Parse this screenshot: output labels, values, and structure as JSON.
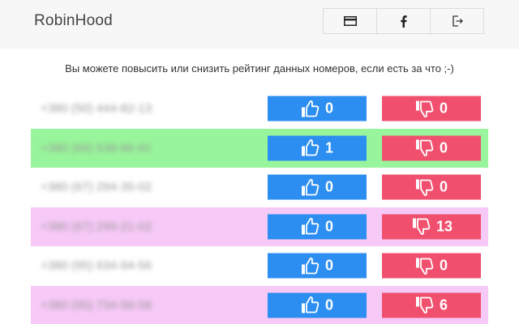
{
  "header": {
    "brand": "RobinHood",
    "buttons": [
      {
        "name": "card-icon"
      },
      {
        "name": "facebook-icon"
      },
      {
        "name": "logout-icon"
      }
    ]
  },
  "intro": "Вы можете повысить или снизить рейтинг данных номеров, если есть за что ;-)",
  "rows": [
    {
      "phone": "+380 (50) 444-82-13",
      "likes": "0",
      "dislikes": "0",
      "highlight": "none"
    },
    {
      "phone": "+380 (66) 538-86-91",
      "likes": "1",
      "dislikes": "0",
      "highlight": "green"
    },
    {
      "phone": "+380 (67) 294-35-02",
      "likes": "0",
      "dislikes": "0",
      "highlight": "none"
    },
    {
      "phone": "+380 (67) 299-21-02",
      "likes": "0",
      "dislikes": "13",
      "highlight": "pink"
    },
    {
      "phone": "+380 (95) 634-94-56",
      "likes": "0",
      "dislikes": "0",
      "highlight": "none"
    },
    {
      "phone": "+380 (95) 734-56-58",
      "likes": "0",
      "dislikes": "6",
      "highlight": "pink"
    }
  ],
  "colors": {
    "like": "#2b8ef0",
    "dislike": "#f0506e",
    "green": "#99f59b",
    "pink": "#f7c9f7"
  },
  "icons": {
    "like": "thumbs-up-icon",
    "dislike": "thumbs-down-icon"
  }
}
